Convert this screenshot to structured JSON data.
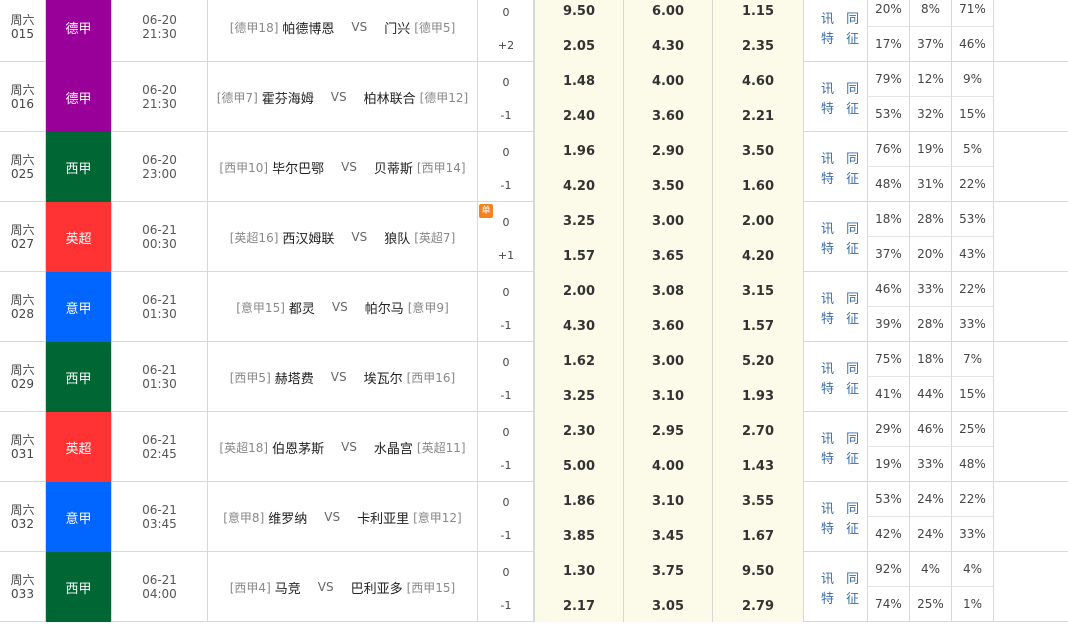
{
  "info_label_1": "讯 同",
  "info_label_2": "特 征",
  "single_badge": "单",
  "vs": "VS",
  "league_colors": {
    "德甲": "#990099",
    "西甲": "#006633",
    "英超": "#ff3333",
    "意甲": "#0066ff"
  },
  "matches": [
    {
      "day": "周六",
      "num": "015",
      "league": "德甲",
      "date": "06-20",
      "time": "21:30",
      "home_rank": "[德甲18]",
      "home": "帕德博恩",
      "away": "门兴",
      "away_rank": "[德甲5]",
      "hcp1": "0",
      "hcp2": "+2",
      "odds1": [
        "9.50",
        "6.00",
        "1.15"
      ],
      "odds2": [
        "2.05",
        "4.30",
        "2.35"
      ],
      "pct1": [
        "20%",
        "8%",
        "71%"
      ],
      "pct2": [
        "17%",
        "37%",
        "46%"
      ]
    },
    {
      "day": "周六",
      "num": "016",
      "league": "德甲",
      "date": "06-20",
      "time": "21:30",
      "home_rank": "[德甲7]",
      "home": "霍芬海姆",
      "away": "柏林联合",
      "away_rank": "[德甲12]",
      "hcp1": "0",
      "hcp2": "-1",
      "odds1": [
        "1.48",
        "4.00",
        "4.60"
      ],
      "odds2": [
        "2.40",
        "3.60",
        "2.21"
      ],
      "pct1": [
        "79%",
        "12%",
        "9%"
      ],
      "pct2": [
        "53%",
        "32%",
        "15%"
      ]
    },
    {
      "day": "周六",
      "num": "025",
      "league": "西甲",
      "date": "06-20",
      "time": "23:00",
      "home_rank": "[西甲10]",
      "home": "毕尔巴鄂",
      "away": "贝蒂斯",
      "away_rank": "[西甲14]",
      "hcp1": "0",
      "hcp2": "-1",
      "odds1": [
        "1.96",
        "2.90",
        "3.50"
      ],
      "odds2": [
        "4.20",
        "3.50",
        "1.60"
      ],
      "pct1": [
        "76%",
        "19%",
        "5%"
      ],
      "pct2": [
        "48%",
        "31%",
        "22%"
      ]
    },
    {
      "day": "周六",
      "num": "027",
      "league": "英超",
      "date": "06-21",
      "time": "00:30",
      "home_rank": "[英超16]",
      "home": "西汉姆联",
      "away": "狼队",
      "away_rank": "[英超7]",
      "hcp1": "0",
      "hcp2": "+1",
      "odds1": [
        "3.25",
        "3.00",
        "2.00"
      ],
      "odds2": [
        "1.57",
        "3.65",
        "4.20"
      ],
      "pct1": [
        "18%",
        "28%",
        "53%"
      ],
      "pct2": [
        "37%",
        "20%",
        "43%"
      ],
      "single": true
    },
    {
      "day": "周六",
      "num": "028",
      "league": "意甲",
      "date": "06-21",
      "time": "01:30",
      "home_rank": "[意甲15]",
      "home": "都灵",
      "away": "帕尔马",
      "away_rank": "[意甲9]",
      "hcp1": "0",
      "hcp2": "-1",
      "odds1": [
        "2.00",
        "3.08",
        "3.15"
      ],
      "odds2": [
        "4.30",
        "3.60",
        "1.57"
      ],
      "pct1": [
        "46%",
        "33%",
        "22%"
      ],
      "pct2": [
        "39%",
        "28%",
        "33%"
      ]
    },
    {
      "day": "周六",
      "num": "029",
      "league": "西甲",
      "date": "06-21",
      "time": "01:30",
      "home_rank": "[西甲5]",
      "home": "赫塔费",
      "away": "埃瓦尔",
      "away_rank": "[西甲16]",
      "hcp1": "0",
      "hcp2": "-1",
      "odds1": [
        "1.62",
        "3.00",
        "5.20"
      ],
      "odds2": [
        "3.25",
        "3.10",
        "1.93"
      ],
      "pct1": [
        "75%",
        "18%",
        "7%"
      ],
      "pct2": [
        "41%",
        "44%",
        "15%"
      ]
    },
    {
      "day": "周六",
      "num": "031",
      "league": "英超",
      "date": "06-21",
      "time": "02:45",
      "home_rank": "[英超18]",
      "home": "伯恩茅斯",
      "away": "水晶宫",
      "away_rank": "[英超11]",
      "hcp1": "0",
      "hcp2": "-1",
      "odds1": [
        "2.30",
        "2.95",
        "2.70"
      ],
      "odds2": [
        "5.00",
        "4.00",
        "1.43"
      ],
      "pct1": [
        "29%",
        "46%",
        "25%"
      ],
      "pct2": [
        "19%",
        "33%",
        "48%"
      ]
    },
    {
      "day": "周六",
      "num": "032",
      "league": "意甲",
      "date": "06-21",
      "time": "03:45",
      "home_rank": "[意甲8]",
      "home": "维罗纳",
      "away": "卡利亚里",
      "away_rank": "[意甲12]",
      "hcp1": "0",
      "hcp2": "-1",
      "odds1": [
        "1.86",
        "3.10",
        "3.55"
      ],
      "odds2": [
        "3.85",
        "3.45",
        "1.67"
      ],
      "pct1": [
        "53%",
        "24%",
        "22%"
      ],
      "pct2": [
        "42%",
        "24%",
        "33%"
      ]
    },
    {
      "day": "周六",
      "num": "033",
      "league": "西甲",
      "date": "06-21",
      "time": "04:00",
      "home_rank": "[西甲4]",
      "home": "马竞",
      "away": "巴利亚多",
      "away_rank": "[西甲15]",
      "hcp1": "0",
      "hcp2": "-1",
      "odds1": [
        "1.30",
        "3.75",
        "9.50"
      ],
      "odds2": [
        "2.17",
        "3.05",
        "2.79"
      ],
      "pct1": [
        "92%",
        "4%",
        "4%"
      ],
      "pct2": [
        "74%",
        "25%",
        "1%"
      ]
    }
  ]
}
